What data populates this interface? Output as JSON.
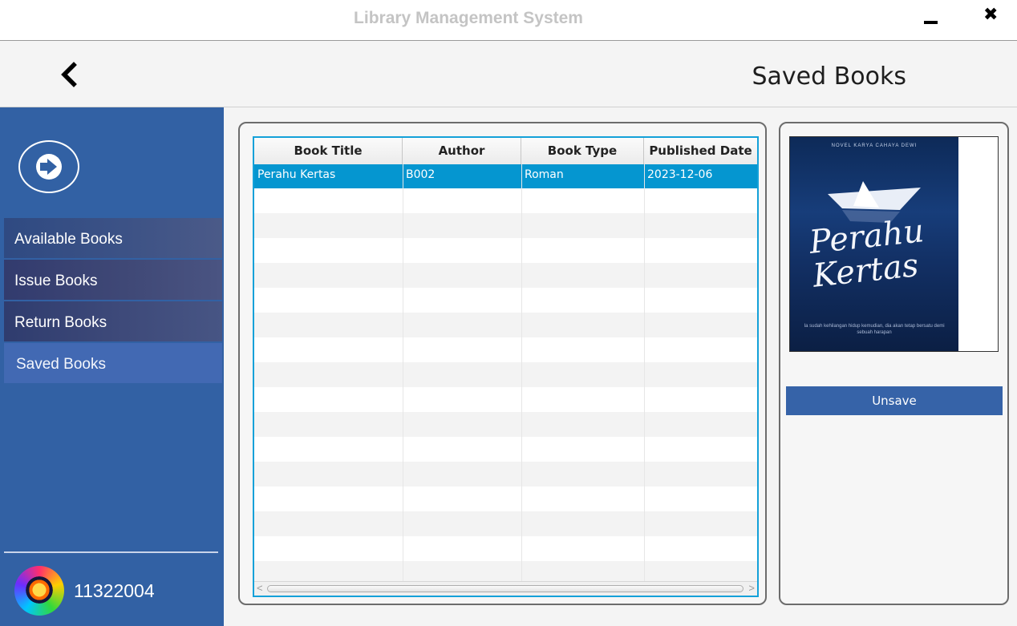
{
  "window": {
    "title": "Library Management System"
  },
  "header": {
    "page_title": "Saved Books"
  },
  "sidebar": {
    "items": [
      {
        "label": "Available Books"
      },
      {
        "label": "Issue Books"
      },
      {
        "label": "Return Books"
      },
      {
        "label": "Saved Books",
        "active": true
      }
    ],
    "user_id": "11322004"
  },
  "table": {
    "columns": [
      "Book Title",
      "Author",
      "Book Type",
      "Published Date"
    ],
    "rows": [
      {
        "title": "Perahu Kertas",
        "author": "B002",
        "type": "Roman",
        "published": "2023-12-06",
        "selected": true
      }
    ],
    "scroll_left_arrow": "<",
    "scroll_right_arrow": ">"
  },
  "book_cover": {
    "top_text": "NOVEL KARYA CAHAYA DEWI",
    "title": "Perahu Kertas",
    "bottom_text": "Ia sudah kehilangan hidup kemudian, dia akan tetap bersatu demi sebuah harapan"
  },
  "actions": {
    "unsave_label": "Unsave"
  },
  "icons": {
    "back": "chevron-left-icon",
    "minimize": "minimize-icon",
    "close": "close-icon",
    "logout": "logout-icon",
    "avatar": "avatar-image"
  },
  "colors": {
    "sidebar": "#3261a4",
    "selected_row": "#0596d0",
    "table_border": "#14a1d9",
    "unsave_button": "#3663a8"
  }
}
